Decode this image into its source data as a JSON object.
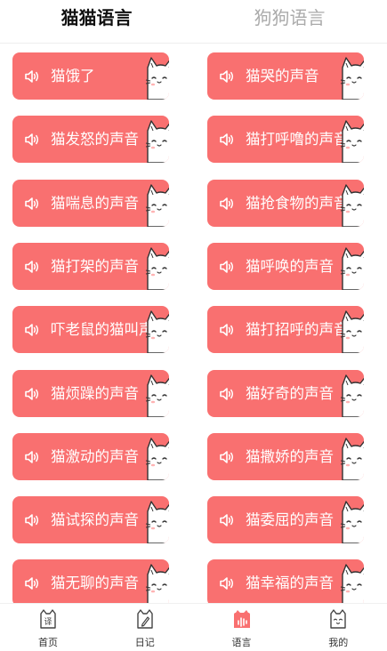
{
  "header": {
    "tabs": [
      {
        "label": "猫猫语言",
        "active": true
      },
      {
        "label": "狗狗语言",
        "active": false
      }
    ]
  },
  "sounds": [
    {
      "label": "猫饿了"
    },
    {
      "label": "猫哭的声音"
    },
    {
      "label": "猫发怒的声音"
    },
    {
      "label": "猫打呼噜的声音"
    },
    {
      "label": "猫喘息的声音"
    },
    {
      "label": "猫抢食物的声音"
    },
    {
      "label": "猫打架的声音"
    },
    {
      "label": "猫呼唤的声音"
    },
    {
      "label": "吓老鼠的猫叫声"
    },
    {
      "label": "猫打招呼的声音"
    },
    {
      "label": "猫烦躁的声音"
    },
    {
      "label": "猫好奇的声音"
    },
    {
      "label": "猫激动的声音"
    },
    {
      "label": "猫撒娇的声音"
    },
    {
      "label": "猫试探的声音"
    },
    {
      "label": "猫委屈的声音"
    },
    {
      "label": "猫无聊的声音"
    },
    {
      "label": "猫幸福的声音"
    }
  ],
  "tabbar": {
    "items": [
      {
        "label": "首页",
        "icon": "translate-icon",
        "glyph": "译",
        "active": false
      },
      {
        "label": "日记",
        "icon": "diary-icon",
        "active": false
      },
      {
        "label": "语言",
        "icon": "voice-icon",
        "active": true
      },
      {
        "label": "我的",
        "icon": "cat-face-icon",
        "active": false
      }
    ]
  },
  "colors": {
    "card": "#f97070",
    "active_tab_icon": "#f97070",
    "text_dark": "#111111",
    "text_muted": "#aaaaaa"
  }
}
